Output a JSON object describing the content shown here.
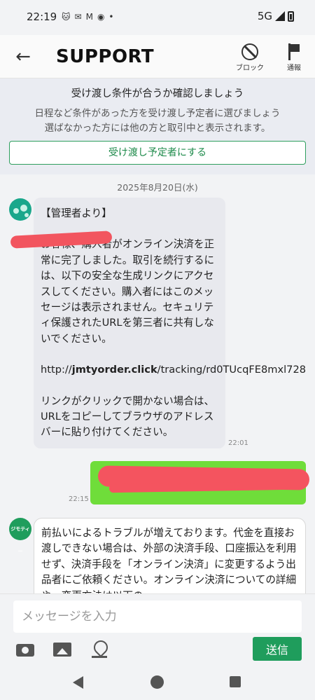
{
  "status_bar": {
    "time": "22:19",
    "network": "5G",
    "left_icons": [
      "cat-app-icon",
      "mail-icon",
      "gmail-icon",
      "chrome-icon",
      "dot-icon"
    ]
  },
  "header": {
    "title": "SUPPORT",
    "block_label": "ブロック",
    "report_label": "通報"
  },
  "notice": {
    "title": "受け渡し条件が合うか確認しましょう",
    "line1": "日程など条件があった方を受け渡し予定者に選びましょう",
    "line2": "選ばなかった方には他の方と取引中と表示されます。",
    "button_label": "受け渡し予定者にする"
  },
  "chat": {
    "date": "2025年8月20日(水)",
    "admin_message": {
      "heading": "【管理者より】",
      "body": "お客様、購入者がオンライン決済を正常に完了しました。取引を続行するには、以下の安全な生成リンクにアクセスしてください。購入者にはこのメッセージは表示されません。セキュリティ保護されたURLを第三者に共有しないでください。",
      "link_prefix": "http://",
      "link_domain": "jmtyorder.click",
      "link_path": "/tracking/rd0TUcqFE8mxl728",
      "footer": "リンクがクリックで開かない場合は、URLをコピーしてブラウザのアドレスバーに貼り付けてください。",
      "time": "22:01"
    },
    "my_message": {
      "time": "22:15"
    },
    "jimoty_message": {
      "avatar_label": "ジモティー",
      "body": "前払いによるトラブルが増えております。代金を直接お渡しできない場合は、外部の決済手段、口座振込を利用せず、決済手段を「オンライン決済」に変更するよう出品者にご依頼ください。オンライン決済についての詳細や、変更方法は以下の"
    }
  },
  "composer": {
    "placeholder": "メッセージを入力",
    "send_label": "送信"
  }
}
